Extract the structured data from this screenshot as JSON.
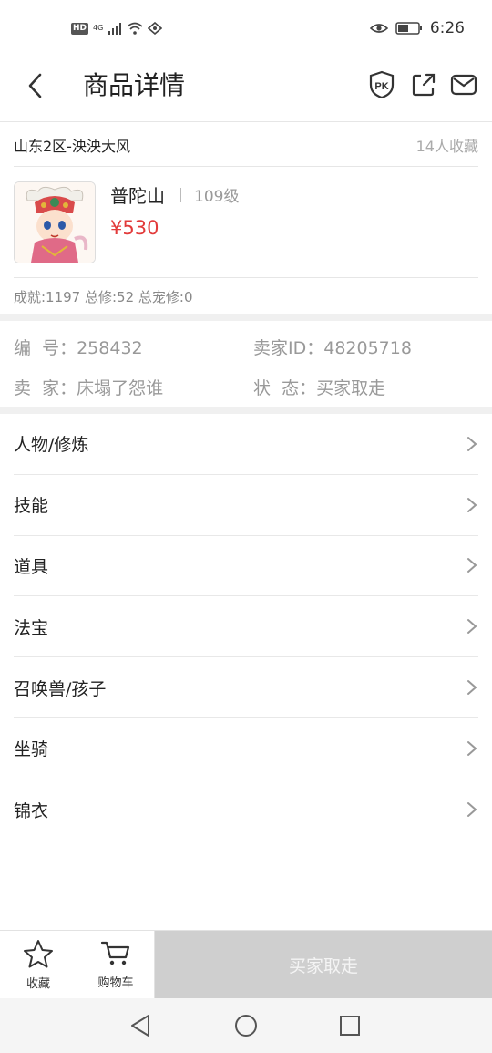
{
  "status_bar": {
    "hd": "HD",
    "network": "4G",
    "time": "6:26"
  },
  "nav": {
    "title": "商品详情",
    "icons": [
      "back-icon",
      "pk-icon",
      "share-icon",
      "mail-icon"
    ]
  },
  "server": {
    "name": "山东2区-泱泱大风",
    "favorites": "14人收藏"
  },
  "goods": {
    "name": "普陀山",
    "level": "109级",
    "price": "¥530",
    "stats": "成就:1197 总修:52 总宠修:0"
  },
  "info": {
    "id_label": "编  号：",
    "id_value": "258432",
    "seller_id_label": "卖家ID：",
    "seller_id_value": "48205718",
    "seller_label": "卖  家：",
    "seller_value": "床塌了怨谁",
    "status_label": "状  态：",
    "status_value": "买家取走"
  },
  "menu": {
    "items": [
      {
        "label": "人物/修炼"
      },
      {
        "label": "技能"
      },
      {
        "label": "道具"
      },
      {
        "label": "法宝"
      },
      {
        "label": "召唤兽/孩子"
      },
      {
        "label": "坐骑"
      },
      {
        "label": "锦衣"
      }
    ]
  },
  "bottom_bar": {
    "favorite_label": "收藏",
    "cart_label": "购物车",
    "main_button_label": "买家取走"
  },
  "colors": {
    "price": "#e23a3a",
    "disabled_button": "#cfcfcf",
    "divider": "#e6e6e6",
    "section_gap": "#f0f0f0"
  }
}
